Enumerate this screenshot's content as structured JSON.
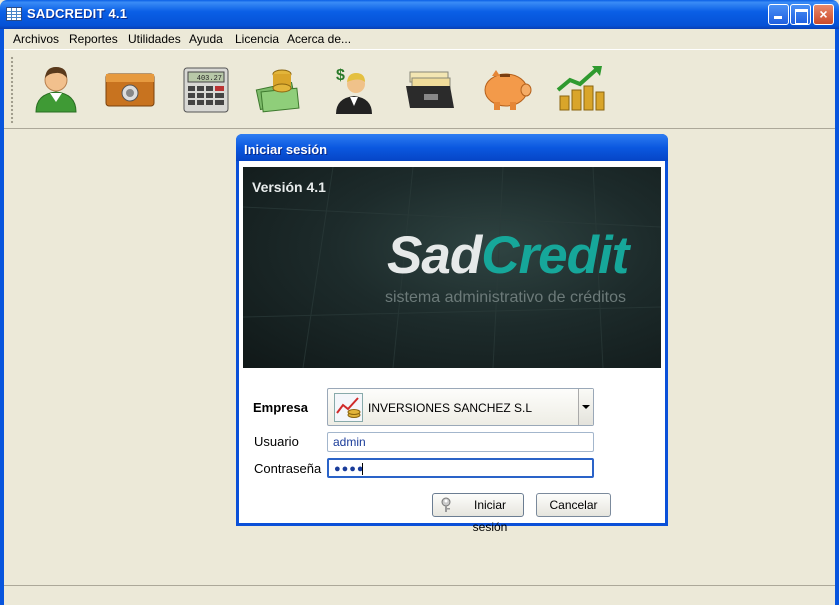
{
  "window": {
    "title": "SADCREDIT 4.1",
    "controls": {
      "minimize": "minimize",
      "maximize": "maximize",
      "close": "×"
    }
  },
  "menu": [
    {
      "label": "Archivos"
    },
    {
      "label": "Reportes"
    },
    {
      "label": "Utilidades"
    },
    {
      "label": "Ayuda"
    },
    {
      "label": "Licencia"
    },
    {
      "label": "Acerca de..."
    }
  ],
  "toolbar": {
    "icons": [
      "user-icon",
      "safe-box-icon",
      "calculator-icon",
      "money-coins-icon",
      "businessman-dollar-icon",
      "card-file-icon",
      "piggy-bank-icon",
      "growth-chart-icon"
    ],
    "calculator_display": "403.27"
  },
  "dialog": {
    "title": "Iniciar sesión",
    "banner": {
      "version": "Versión 4.1",
      "brand_part1": "Sad",
      "brand_part2": "Credit",
      "tagline": "sistema administrativo de créditos"
    },
    "empresa_label": "Empresa",
    "empresa_value": "INVERSIONES SANCHEZ S.L",
    "usuario_label": "Usuario",
    "usuario_value": "admin",
    "password_label": "Contraseña",
    "password_dots": "●●●●",
    "login_button": "Iniciar sesión",
    "cancel_button": "Cancelar"
  },
  "colors": {
    "titlebar_blue": "#0a5fe6",
    "brand_teal": "#16a79a",
    "window_bg": "#ece9d8"
  }
}
